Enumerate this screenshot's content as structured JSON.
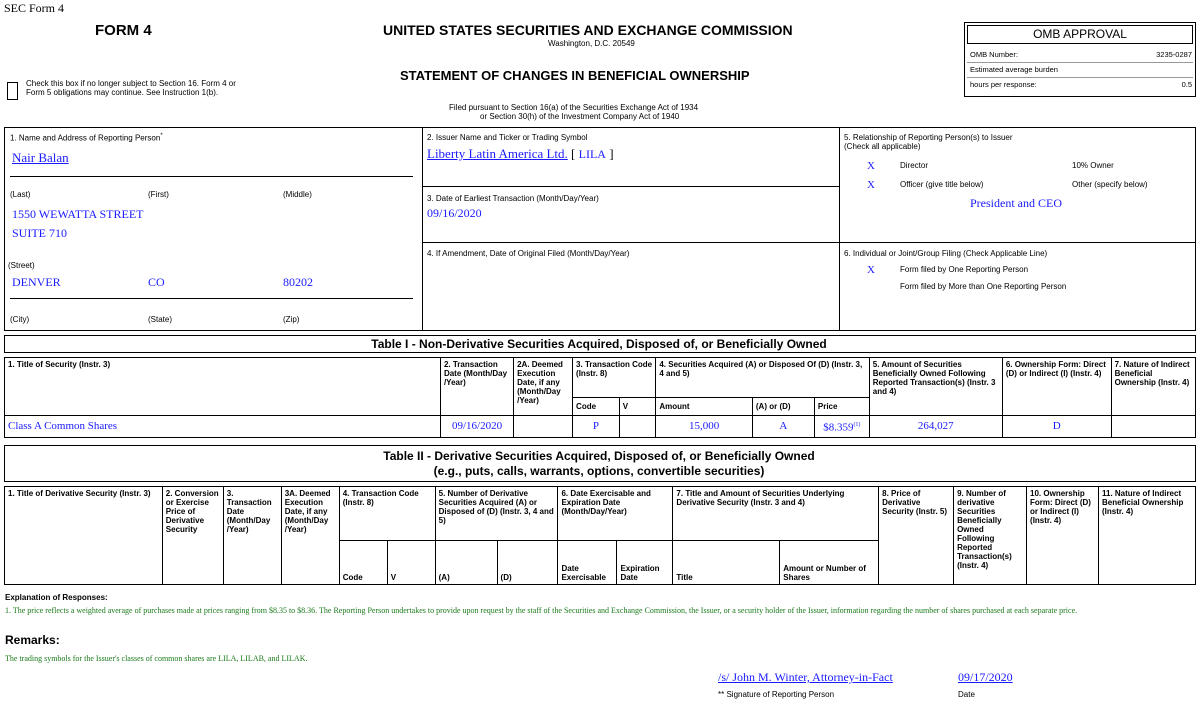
{
  "header": {
    "sec_form": "SEC Form 4",
    "form_label": "FORM 4",
    "checkbox_text": "Check this box if no longer subject to Section 16. Form 4 or Form 5 obligations may continue. See Instruction 1(b).",
    "agency": "UNITED STATES SECURITIES AND EXCHANGE COMMISSION",
    "city": "Washington, D.C. 20549",
    "statement": "STATEMENT OF CHANGES IN BENEFICIAL OWNERSHIP",
    "filed_line1": "Filed pursuant to Section 16(a) of the Securities Exchange Act of 1934",
    "filed_line2": "or Section 30(h) of the Investment Company Act of 1940"
  },
  "omb": {
    "title": "OMB APPROVAL",
    "number_label": "OMB Number:",
    "number": "3235-0287",
    "burden_label": "Estimated average burden",
    "hours_label": "hours per response:",
    "hours": "0.5"
  },
  "box1": {
    "label": "1. Name and Address of Reporting Person",
    "star": "*",
    "name": "Nair Balan",
    "last": "(Last)",
    "first": "(First)",
    "middle": "(Middle)",
    "street1": "1550 WEWATTA STREET",
    "street2": "SUITE 710",
    "street_label": "(Street)",
    "city": "DENVER",
    "state": "CO",
    "zip": "80202",
    "city_label": "(City)",
    "state_label": "(State)",
    "zip_label": "(Zip)"
  },
  "box2": {
    "label": "2. Issuer Name and Ticker or Trading Symbol",
    "issuer": "Liberty Latin America Ltd.",
    "ticker_open": "[",
    "ticker": "LILA",
    "ticker_close": "]"
  },
  "box3": {
    "label": "3. Date of Earliest Transaction (Month/Day/Year)",
    "date": "09/16/2020"
  },
  "box4": {
    "label": "4. If Amendment, Date of Original Filed (Month/Day/Year)"
  },
  "box5": {
    "label": "5. Relationship of Reporting Person(s) to Issuer",
    "sublabel": "(Check all applicable)",
    "x": "X",
    "director": "Director",
    "ten_pct": "10% Owner",
    "officer": "Officer (give title below)",
    "other": "Other (specify below)",
    "title": "President and CEO"
  },
  "box6": {
    "label": "6. Individual or Joint/Group Filing (Check Applicable Line)",
    "x": "X",
    "one": "Form filed by One Reporting Person",
    "more": "Form filed by More than One Reporting Person"
  },
  "table1": {
    "title": "Table I - Non-Derivative Securities Acquired, Disposed of, or Beneficially Owned",
    "h1": "1. Title of Security (Instr. 3)",
    "h2": "2. Transaction Date (Month/Day /Year)",
    "h2a": "2A. Deemed Execution Date, if any (Month/Day /Year)",
    "h3": "3. Transaction Code (Instr. 8)",
    "h4": "4. Securities Acquired (A) or Disposed Of (D) (Instr. 3, 4 and 5)",
    "h5": "5. Amount of Securities Beneficially Owned Following Reported Transaction(s) (Instr. 3 and 4)",
    "h6": "6. Ownership Form: Direct (D) or Indirect (I) (Instr. 4)",
    "h7": "7. Nature of Indirect Beneficial Ownership (Instr. 4)",
    "code": "Code",
    "v": "V",
    "amount": "Amount",
    "aord": "(A) or (D)",
    "price": "Price",
    "row": {
      "title": "Class A Common Shares",
      "date": "09/16/2020",
      "deemed": "",
      "code": "P",
      "v": "",
      "amount": "15,000",
      "aord": "A",
      "price": "$8.359",
      "price_fn": "(1)",
      "owned": "264,027",
      "form": "D",
      "nature": ""
    }
  },
  "table2": {
    "title1": "Table II - Derivative Securities Acquired, Disposed of, or Beneficially Owned",
    "title2": "(e.g., puts, calls, warrants, options, convertible securities)",
    "h1": "1. Title of Derivative Security (Instr. 3)",
    "h2": "2. Conversion or Exercise Price of Derivative Security",
    "h3": "3. Transaction Date (Month/Day /Year)",
    "h3a": "3A. Deemed Execution Date, if any (Month/Day /Year)",
    "h4": "4. Transaction Code (Instr. 8)",
    "h5": "5. Number of Derivative Securities Acquired (A) or Disposed of (D) (Instr. 3, 4 and 5)",
    "h6": "6. Date Exercisable and Expiration Date (Month/Day/Year)",
    "h7": "7. Title and Amount of Securities Underlying Derivative Security (Instr. 3 and 4)",
    "h8": "8. Price of Derivative Security (Instr. 5)",
    "h9": "9. Number of derivative Securities Beneficially Owned Following Reported Transaction(s) (Instr. 4)",
    "h10": "10. Ownership Form: Direct (D) or Indirect (I) (Instr. 4)",
    "h11": "11. Nature of Indirect Beneficial Ownership (Instr. 4)",
    "code": "Code",
    "v": "V",
    "a": "(A)",
    "d": "(D)",
    "date_ex": "Date Exercisable",
    "exp": "Expiration Date",
    "title": "Title",
    "amount": "Amount or Number of Shares"
  },
  "footer": {
    "explanation": "Explanation of Responses:",
    "fn1": "1. The price reflects a weighted average of purchases made at prices ranging from $8.35 to $8.36. The Reporting Person undertakes to provide upon request by the staff of the Securities and Exchange Commission, the Issuer, or a security holder of the Issuer, information regarding the number of shares purchased at each separate price.",
    "remarks": "Remarks:",
    "remarks_text": "The trading symbols for the Issuer's classes of common shares are LILA, LILAB, and LILAK.",
    "signature": "/s/ John M. Winter, Attorney-in-Fact",
    "sig_date": "09/17/2020",
    "sig_label": "** Signature of Reporting Person",
    "date_label": "Date"
  },
  "colors": {
    "value_blue": "#1a1aff",
    "footnote_green": "#1a7a1a"
  }
}
